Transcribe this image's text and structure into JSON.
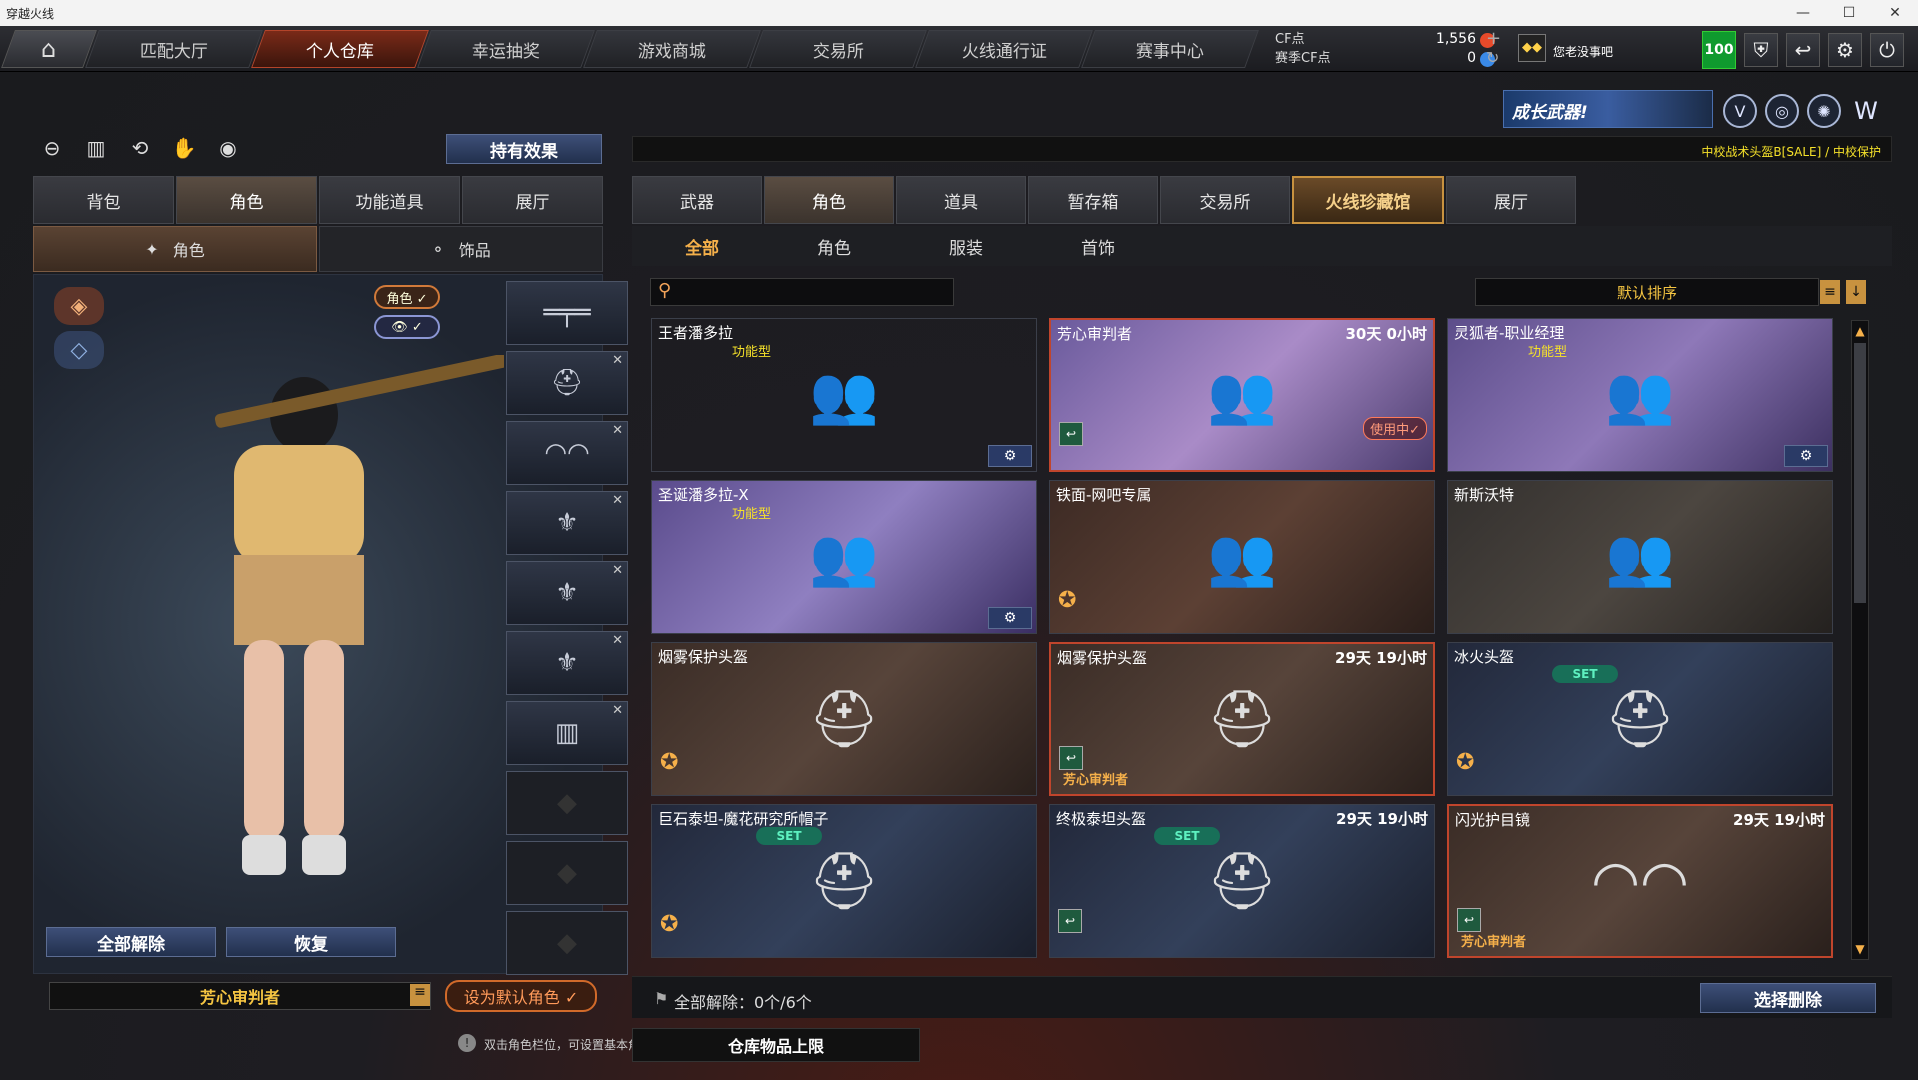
{
  "window": {
    "title": "穿越火线",
    "minimize": "—",
    "maximize": "☐",
    "close": "✕"
  },
  "nav": {
    "tabs": [
      "匹配大厅",
      "个人仓库",
      "幸运抽奖",
      "游戏商城",
      "交易所",
      "火线通行证",
      "赛事中心"
    ],
    "active": 1
  },
  "currency": {
    "cf_label": "CF点",
    "cf_value": "1,556",
    "season_label": "赛季CF点",
    "season_value": "0"
  },
  "user": {
    "name": "您老没事吧",
    "level": "100"
  },
  "banner": {
    "text": "成长武器!"
  },
  "marquee": "中校战术头盔B[SALE] / 中校保护",
  "left": {
    "effects_button": "持有效果",
    "tabs": [
      "背包",
      "角色",
      "功能道具",
      "展厅"
    ],
    "active_tab": 1,
    "subtabs": [
      "角色",
      "饰品"
    ],
    "active_subtab": 0,
    "pill_role": "角色 ✓",
    "pill_eye": "👁 ✓",
    "release_all": "全部解除",
    "restore": "恢复",
    "default_name": "芳心审判者",
    "set_default": "设为默认角色 ✓",
    "hint": "双击角色栏位，可设置基本角色。"
  },
  "right": {
    "tabs": [
      "武器",
      "角色",
      "道具",
      "暂存箱",
      "交易所",
      "火线珍藏馆",
      "展厅"
    ],
    "active_tab": 1,
    "subtabs": [
      "全部",
      "角色",
      "服装",
      "首饰"
    ],
    "active_subtab": 0,
    "sort": "默认排序",
    "footer_text": "全部解除：0个/6个",
    "select_delete": "选择删除",
    "limit": "仓库物品上限"
  },
  "cards": [
    {
      "name": "王者潘多拉",
      "tag": "功能型",
      "time": "",
      "owner": "",
      "set": false,
      "inuse": "",
      "gear": true,
      "bg": "linear-gradient(135deg,#6b5a20,#a48a35 50,#3a3018)"
    },
    {
      "name": "芳心审判者",
      "tag": "",
      "time": "30天 0小时",
      "owner": "",
      "set": false,
      "inuse": "使用中✓",
      "gear": false,
      "bg": "linear-gradient(135deg,#6a5a9c,#a98bc7,#4a3c6e)"
    },
    {
      "name": "灵狐者-职业经理",
      "tag": "功能型",
      "time": "",
      "owner": "",
      "set": false,
      "inuse": "",
      "gear": true,
      "bg": "linear-gradient(135deg,#5c4d8a,#8e78b8,#3c3060)"
    },
    {
      "name": "圣诞潘多拉-X",
      "tag": "功能型",
      "time": "",
      "owner": "",
      "set": false,
      "inuse": "",
      "gear": true,
      "bg": "linear-gradient(135deg,#5a4b8c,#8f7fc0,#3a2e62)"
    },
    {
      "name": "铁面-网吧专属",
      "tag": "",
      "time": "",
      "owner": "",
      "set": false,
      "inuse": "",
      "gear": false,
      "bg": "linear-gradient(135deg,#3c2a24,#5c4034,#2a1e1a)"
    },
    {
      "name": "新斯沃特",
      "tag": "",
      "time": "",
      "owner": "",
      "set": false,
      "inuse": "",
      "gear": false,
      "bg": "linear-gradient(135deg,#33302e,#4c4640,#24211f)"
    },
    {
      "name": "烟雾保护头盔",
      "tag": "",
      "time": "",
      "owner": "",
      "set": false,
      "inuse": "",
      "gear": false,
      "bg": "linear-gradient(135deg,#3a2c26,#57443a,#2a201c)"
    },
    {
      "name": "烟雾保护头盔",
      "tag": "",
      "time": "29天 19小时",
      "owner": "芳心审判者",
      "set": false,
      "inuse": "",
      "gear": false,
      "bg": "linear-gradient(135deg,#3a2c26,#57443a,#2a201c)"
    },
    {
      "name": "冰火头盔",
      "tag": "",
      "time": "",
      "owner": "",
      "set": true,
      "inuse": "",
      "gear": false,
      "bg": "linear-gradient(135deg,#22283a,#33405a,#1a1f2c)"
    },
    {
      "name": "巨石泰坦-魔花研究所帽子",
      "tag": "",
      "time": "",
      "owner": "",
      "set": true,
      "inuse": "",
      "gear": false,
      "bg": "linear-gradient(135deg,#22283a,#33405a,#1a1f2c)"
    },
    {
      "name": "终极泰坦头盔",
      "tag": "",
      "time": "29天 19小时",
      "owner": "",
      "set": true,
      "inuse": "",
      "gear": false,
      "bg": "linear-gradient(135deg,#22283a,#33405a,#1a1f2c)"
    },
    {
      "name": "闪光护目镜",
      "tag": "",
      "time": "29天 19小时",
      "owner": "芳心审判者",
      "set": false,
      "inuse": "",
      "gear": false,
      "bg": "linear-gradient(135deg,#3a2c26,#57443a,#2a201c)"
    }
  ],
  "card_set_label": "SET"
}
